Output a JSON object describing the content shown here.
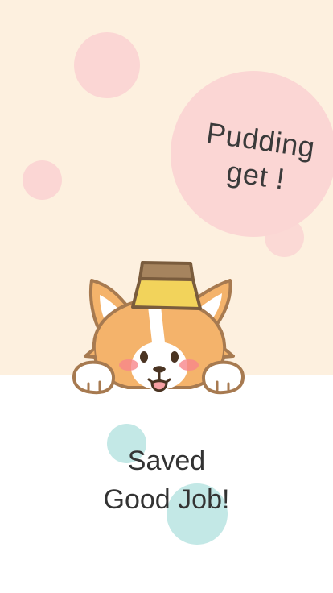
{
  "reward": {
    "line1": "Pudding",
    "line2": "get !"
  },
  "result": {
    "line1": "Saved",
    "line2": "Good Job!"
  },
  "colors": {
    "top_background": "#fdf0df",
    "bottom_background": "#ffffff",
    "pink_bubble": "#fbd6d4",
    "teal_bubble": "#c3e8e6",
    "text": "#333333"
  },
  "icons": {
    "mascot": "corgi-with-pudding-icon"
  }
}
